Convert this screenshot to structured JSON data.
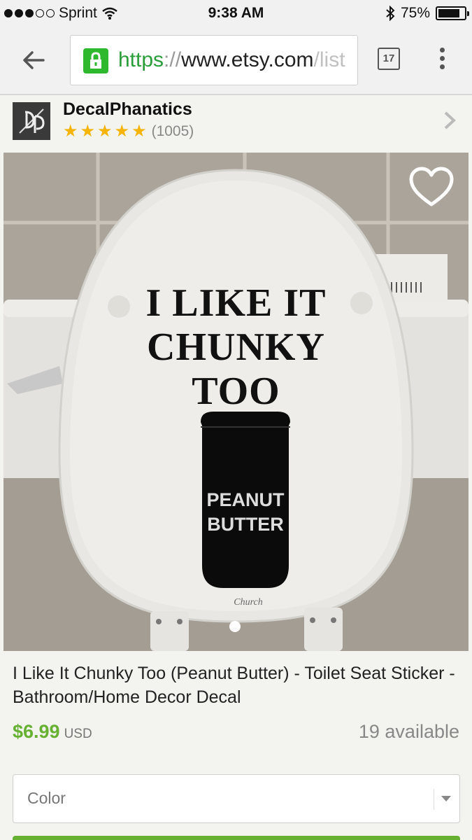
{
  "status_bar": {
    "carrier": "Sprint",
    "time": "9:38 AM",
    "battery": "75%",
    "battery_fraction": 0.75,
    "signal_bars": 3,
    "signal_total": 5
  },
  "browser": {
    "url_scheme": "https",
    "url_sep": "://",
    "url_host": "www.etsy.com",
    "url_tail": "/list",
    "tab_count": "17"
  },
  "shop": {
    "name": "DecalPhanatics",
    "rating_stars": 5,
    "review_count": "(1005)"
  },
  "listing": {
    "image_text": {
      "line1": "I LIKE IT",
      "line2": "CHUNKY",
      "line3": "TOO",
      "jar_line1": "PEANUT",
      "jar_line2": "BUTTER",
      "brand": "Church"
    },
    "title": "I Like It Chunky Too (Peanut Butter) - Toilet Seat Sticker - Bathroom/Home Decor Decal",
    "price": "$6.99",
    "currency": "USD",
    "available": "19 available",
    "color_select_label": "Color"
  },
  "colors": {
    "accent_green": "#66b032",
    "star": "#f4b400",
    "lock_green": "#2eb82e"
  }
}
